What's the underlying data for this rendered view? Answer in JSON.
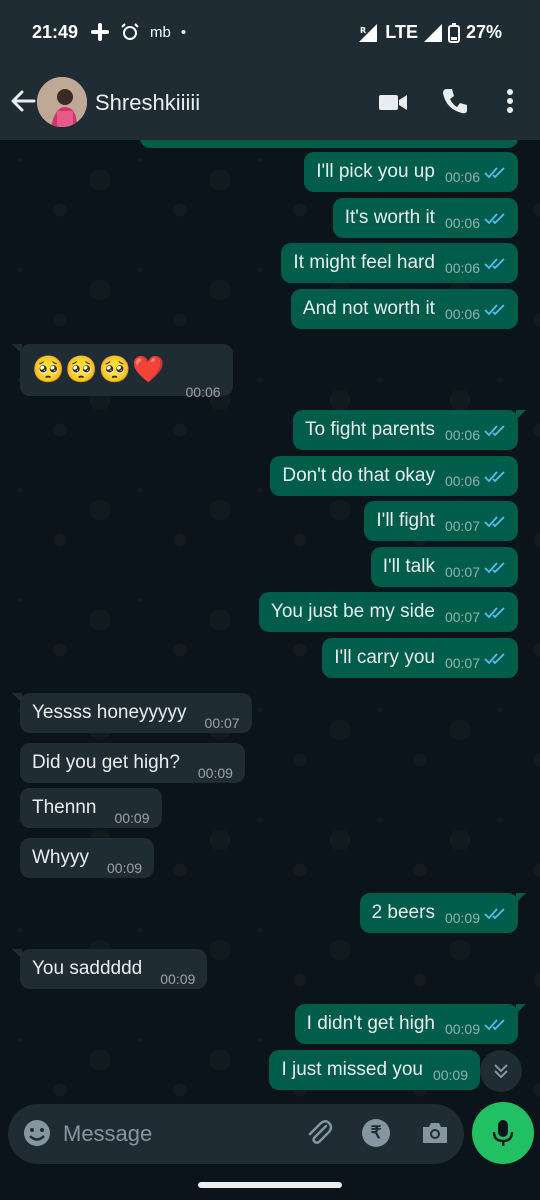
{
  "status_bar": {
    "time": "21:49",
    "carrier_label": "mb",
    "network": "LTE",
    "battery": "27%"
  },
  "header": {
    "contact_name": "Shreshkiiiii"
  },
  "messages": [
    {
      "dir": "out",
      "text": "I'll pick you up",
      "time": "00:06"
    },
    {
      "dir": "out",
      "text": "It's worth it",
      "time": "00:06"
    },
    {
      "dir": "out",
      "text": "It might feel hard",
      "time": "00:06"
    },
    {
      "dir": "out",
      "text": "And not worth it",
      "time": "00:06"
    },
    {
      "dir": "in",
      "text": "🥺🥺🥺❤️",
      "time": "00:06"
    },
    {
      "dir": "out",
      "text": "To fight parents",
      "time": "00:06"
    },
    {
      "dir": "out",
      "text": "Don't do that okay",
      "time": "00:06"
    },
    {
      "dir": "out",
      "text": "I'll fight",
      "time": "00:07"
    },
    {
      "dir": "out",
      "text": "I'll talk",
      "time": "00:07"
    },
    {
      "dir": "out",
      "text": "You just be my side",
      "time": "00:07"
    },
    {
      "dir": "out",
      "text": "I'll carry you",
      "time": "00:07"
    },
    {
      "dir": "in",
      "text": "Yessss honeyyyyy",
      "time": "00:07"
    },
    {
      "dir": "in",
      "text": "Did you get high?",
      "time": "00:09"
    },
    {
      "dir": "in",
      "text": "Thennn",
      "time": "00:09"
    },
    {
      "dir": "in",
      "text": "Whyyy",
      "time": "00:09"
    },
    {
      "dir": "out",
      "text": "2 beers",
      "time": "00:09"
    },
    {
      "dir": "in",
      "text": "You saddddd",
      "time": "00:09"
    },
    {
      "dir": "out",
      "text": "I didn't get high",
      "time": "00:09"
    },
    {
      "dir": "out",
      "text": "I just missed you",
      "time": "00:09"
    }
  ],
  "input": {
    "placeholder": "Message",
    "value": ""
  },
  "colors": {
    "outgoing_bubble": "#005c4b",
    "incoming_bubble": "#202c33",
    "header": "#1f2c34",
    "background": "#0b141a",
    "accent": "#21c063",
    "read_ticks": "#53bdeb"
  }
}
